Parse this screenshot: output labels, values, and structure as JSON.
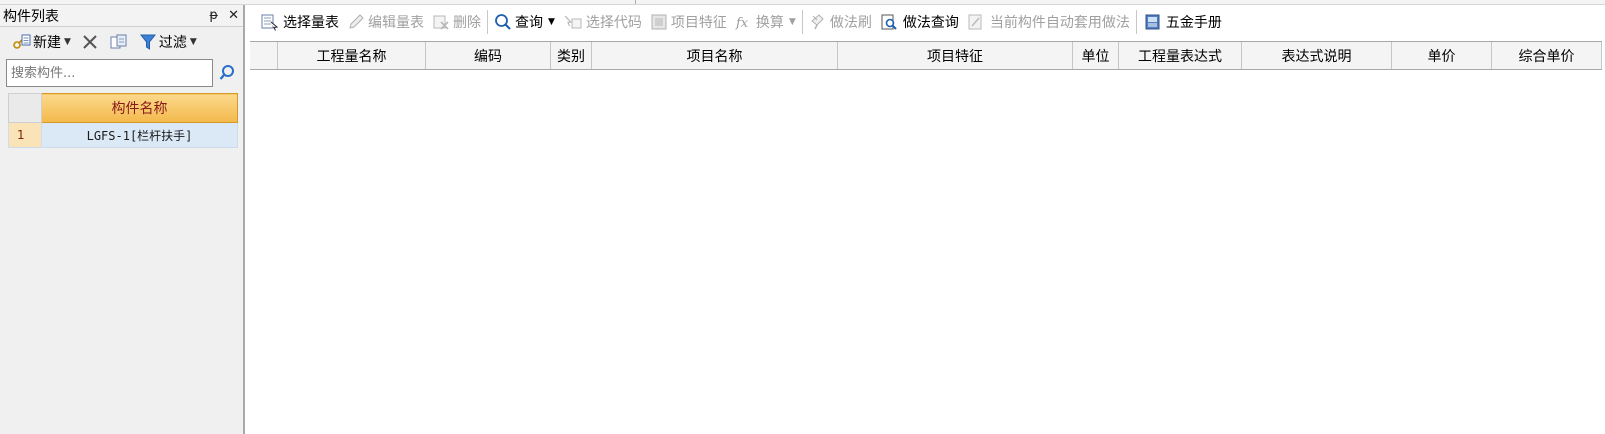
{
  "component_panel": {
    "title": "构件列表",
    "pin_glyph": "ᵽ",
    "close_glyph": "✕",
    "toolbar": {
      "new_label": "新建",
      "filter_label": "过滤"
    },
    "search": {
      "placeholder": "搜索构件..."
    },
    "table": {
      "header": "构件名称",
      "rows": [
        {
          "index": "1",
          "name": "LGFS-1[栏杆扶手]"
        }
      ]
    }
  },
  "main_toolbar": {
    "select_table": "选择量表",
    "edit_table": "编辑量表",
    "delete": "删除",
    "query": "查询",
    "select_code": "选择代码",
    "item_feature": "项目特征",
    "convert": "换算",
    "method_brush": "做法刷",
    "method_query": "做法查询",
    "auto_method": "当前构件自动套用做法",
    "hardware_manual": "五金手册"
  },
  "grid": {
    "columns": [
      "",
      "工程量名称",
      "编码",
      "类别",
      "项目名称",
      "项目特征",
      "单位",
      "工程量表达式",
      "表达式说明",
      "单价",
      "综合单价"
    ]
  },
  "colors": {
    "header_orange": "#f3b94c",
    "selected_row_blue": "#dbe8f6",
    "disabled_text": "#a0a0a0",
    "icon_blue": "#1f5fb0"
  },
  "icons": [
    "new-icon",
    "delete-x-icon",
    "copy-icon",
    "filter-icon",
    "search-icon",
    "select-table-icon",
    "edit-icon",
    "delete-icon",
    "query-icon",
    "select-code-icon",
    "feature-icon",
    "fx-icon",
    "brush-icon",
    "method-query-icon",
    "auto-method-icon",
    "manual-icon"
  ]
}
